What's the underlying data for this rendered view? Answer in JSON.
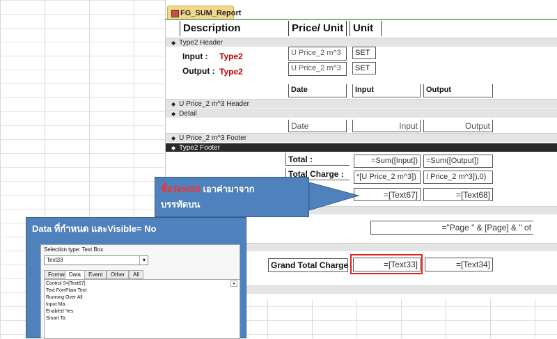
{
  "report": {
    "tab_title": "FG_SUM_Report",
    "page_header": {
      "description": "Description",
      "price_unit": "Price/ Unit",
      "unit": "Unit"
    },
    "bands": {
      "type2_header": "Type2 Header",
      "uprice_header": "U Price_2 m^3 Header",
      "detail": "Detail",
      "uprice_footer": "U Price_2 m^3 Footer",
      "type2_footer": "Type2 Footer"
    },
    "type2": {
      "input_label": "Input :",
      "input_value": "Type2",
      "output_label": "Output :",
      "output_value": "Type2",
      "price1": "U Price_2 m^3",
      "unit1": "SET",
      "price2": "U Price_2 m^3",
      "unit2": "SET"
    },
    "columns": {
      "date": "Date",
      "input": "Input",
      "output": "Output"
    },
    "detail": {
      "date": "Date",
      "input": "Input",
      "output": "Output"
    },
    "footer": {
      "total_label": "Total :",
      "total_input": "=Sum([Input])",
      "total_output": "=Sum([Output])",
      "charge_label": "Total Charge :",
      "charge_input": "*[U Price_2 m^3])",
      "charge_output": "! Price_2 m^3]),0)",
      "text67": "=[Text67]",
      "text68": "=[Text68]"
    },
    "page_footer": {
      "page_expr": "=\"Page \" & [Page] & \" of"
    },
    "grand": {
      "label": "Grand Total Charge :",
      "text33": "=[Text33]",
      "text34": "=[Text34]"
    }
  },
  "callout": {
    "line1_red": "ชื่อText33",
    "line1_rest": " เอาค่ามาจาก",
    "line2": "บรรทัดบน"
  },
  "panel": {
    "title": "Data ที่กำหนด  และVisible= No",
    "selection_type": "Selection type:  Text Box",
    "selected": "Text33",
    "tabs": [
      "Format",
      "Data",
      "Event",
      "Other",
      "All"
    ],
    "props": [
      {
        "key": "Control Source",
        "value": "=[Text67]"
      },
      {
        "key": "Text Format",
        "value": "Plain Text"
      },
      {
        "key": "Running Sum",
        "value": "Over All"
      },
      {
        "key": "Input Mask",
        "value": ""
      },
      {
        "key": "Enabled",
        "value": "Yes"
      },
      {
        "key": "Smart Tags",
        "value": ""
      }
    ]
  },
  "colors": {
    "callout": "#4f81bd",
    "highlight": "#e02020",
    "label_red": "#c00000"
  }
}
